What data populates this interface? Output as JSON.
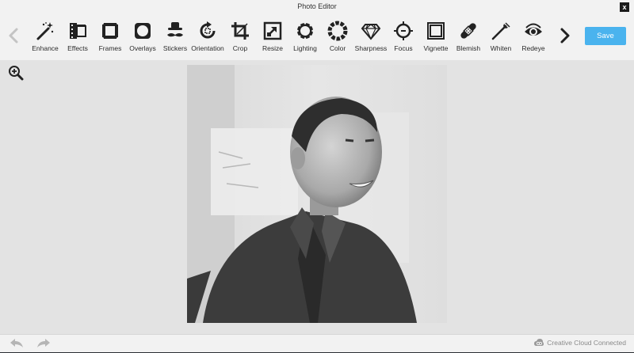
{
  "window": {
    "title": "Photo Editor",
    "close_label": "x"
  },
  "toolbar": {
    "tools": [
      {
        "label": "Enhance",
        "icon": "magic-wand-icon"
      },
      {
        "label": "Effects",
        "icon": "film-icon"
      },
      {
        "label": "Frames",
        "icon": "frame-icon"
      },
      {
        "label": "Overlays",
        "icon": "overlay-icon"
      },
      {
        "label": "Stickers",
        "icon": "mustache-hat-icon"
      },
      {
        "label": "Orientation",
        "icon": "rotate-icon"
      },
      {
        "label": "Crop",
        "icon": "crop-icon"
      },
      {
        "label": "Resize",
        "icon": "resize-icon"
      },
      {
        "label": "Lighting",
        "icon": "sun-icon"
      },
      {
        "label": "Color",
        "icon": "color-wheel-icon"
      },
      {
        "label": "Sharpness",
        "icon": "diamond-icon"
      },
      {
        "label": "Focus",
        "icon": "focus-icon"
      },
      {
        "label": "Vignette",
        "icon": "vignette-icon"
      },
      {
        "label": "Blemish",
        "icon": "bandage-icon"
      },
      {
        "label": "Whiten",
        "icon": "toothbrush-icon"
      },
      {
        "label": "Redeye",
        "icon": "eye-icon"
      }
    ],
    "save_label": "Save"
  },
  "footer": {
    "status": "Creative Cloud Connected"
  },
  "colors": {
    "accent": "#4ab3ee",
    "toolbar_bg": "#f2f2f2",
    "canvas_bg": "#e3e3e3"
  }
}
